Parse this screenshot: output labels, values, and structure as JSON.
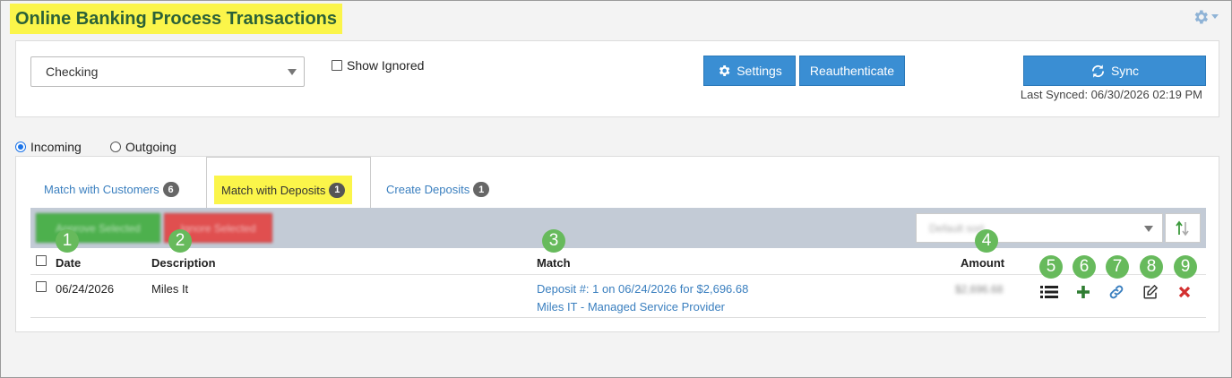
{
  "page": {
    "title": "Online Banking Process Transactions"
  },
  "top": {
    "account_select": "Checking",
    "show_ignored_label": "Show Ignored",
    "settings_label": "Settings",
    "reauth_label": "Reauthenticate",
    "sync_label": "Sync",
    "last_synced": "Last Synced: 06/30/2026 02:19 PM"
  },
  "direction": {
    "incoming": "Incoming",
    "outgoing": "Outgoing",
    "selected": "incoming"
  },
  "tabs": [
    {
      "label": "Match with Customers",
      "count": "6"
    },
    {
      "label": "Match with Deposits",
      "count": "1"
    },
    {
      "label": "Create Deposits",
      "count": "1"
    }
  ],
  "toolbar": {
    "approve_selected": "Approve Selected",
    "ignore_selected": "Ignore Selected",
    "sort_select": "Default sort"
  },
  "table": {
    "columns": {
      "date": "Date",
      "description": "Description",
      "match": "Match",
      "amount": "Amount"
    },
    "rows": [
      {
        "date": "06/24/2026",
        "description": "Miles It",
        "match_line1": "Deposit #: 1 on 06/24/2026 for $2,696.68",
        "match_line2": "Miles IT - Managed Service Provider",
        "amount": "$2,696.68"
      }
    ]
  },
  "callouts": [
    "1",
    "2",
    "3",
    "4",
    "5",
    "6",
    "7",
    "8",
    "9"
  ],
  "icons": {
    "row_actions": [
      "list-icon",
      "plus-icon",
      "link-icon",
      "edit-icon",
      "close-icon"
    ]
  },
  "colors": {
    "highlight": "#fbf54a",
    "title": "#2b6138",
    "primary": "#3a8ed3",
    "success": "#4db04d",
    "danger": "#e04f4f",
    "callout": "#67ba5c"
  }
}
